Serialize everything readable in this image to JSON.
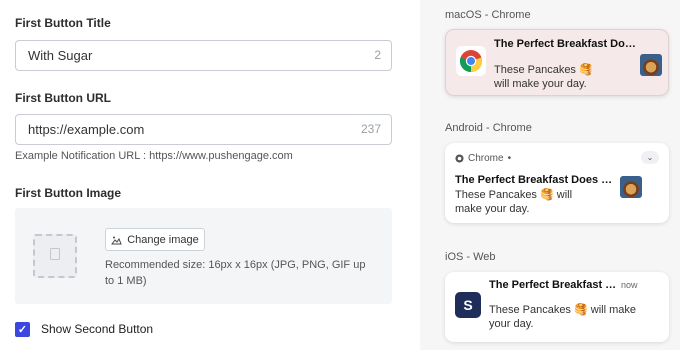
{
  "form": {
    "button_title_label": "First Button Title",
    "button_title_value": "With Sugar",
    "button_title_count": "2",
    "button_url_label": "First Button URL",
    "button_url_value": "https://example.com",
    "button_url_count": "237",
    "example_url": "Example Notification URL : https://www.pushengage.com",
    "button_image_label": "First Button Image",
    "change_image_label": "Change image",
    "recommended": "Recommended size: 16px x 16px (JPG, PNG, GIF up to 1 MB)",
    "show_second_label": "Show Second Button",
    "show_second_checked": true
  },
  "preview": {
    "mac": {
      "title": "macOS - Chrome",
      "notif_title": "The Perfect Breakfast Does Exist",
      "notif_body": "These Pancakes 🥞 will make your day.",
      "icon": "chrome-logo-icon"
    },
    "android": {
      "title": "Android - Chrome",
      "app_name": "Chrome",
      "app_dot": "•",
      "notif_title": "The Perfect Breakfast Does Exist",
      "notif_body": "These Pancakes 🥞 will make your day."
    },
    "ios": {
      "title": "iOS - Web",
      "notif_title": "The Perfect Breakfast Does Exist",
      "time": "now",
      "notif_body": "These Pancakes 🥞 will make your day.",
      "app_letter": "S"
    }
  },
  "colors": {
    "checkbox": "#3b47dd",
    "ios_app_icon": "#1f2d5a",
    "mac_card_bg": "#f6e9e9",
    "preview_bg": "#f6f6f7"
  }
}
